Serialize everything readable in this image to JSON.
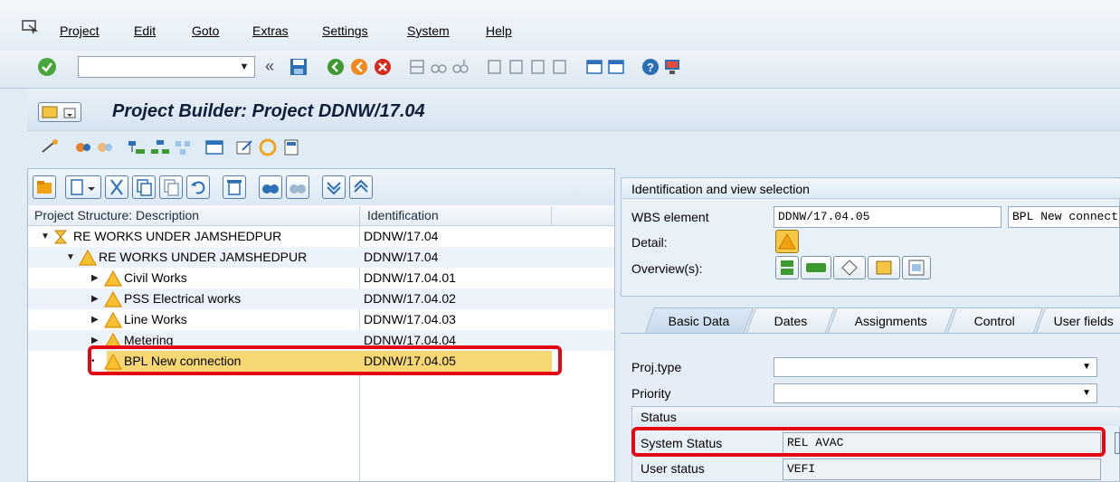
{
  "menu": {
    "items": [
      "Project",
      "Edit",
      "Goto",
      "Extras",
      "Settings",
      "System",
      "Help"
    ]
  },
  "toolbar": {
    "command_value": "",
    "icons": [
      "enter-icon",
      "back-icon",
      "save-icon",
      "back-green-icon",
      "exit-icon",
      "cancel-icon",
      "print-icon",
      "find-icon",
      "find-next-icon",
      "first-page-icon",
      "prev-page-icon",
      "next-page-icon",
      "last-page-icon",
      "new-session-icon",
      "shortcut-icon",
      "help-icon",
      "customize-icon"
    ]
  },
  "title": {
    "text": "Project Builder: Project DDNW/17.04"
  },
  "tree": {
    "col_description": "Project Structure: Description",
    "col_identification": "Identification",
    "rows": [
      {
        "description": "RE WORKS UNDER JAMSHEDPUR",
        "id": "DDNW/17.04",
        "level": 0,
        "icon": "project-icon",
        "expanded": true
      },
      {
        "description": "RE WORKS UNDER JAMSHEDPUR",
        "id": "DDNW/17.04",
        "level": 1,
        "icon": "warning-icon",
        "expanded": true
      },
      {
        "description": "Civil Works",
        "id": "DDNW/17.04.01",
        "level": 2,
        "icon": "warning-icon",
        "expanded": false
      },
      {
        "description": "PSS Electrical works",
        "id": "DDNW/17.04.02",
        "level": 2,
        "icon": "warning-icon",
        "expanded": false
      },
      {
        "description": "Line Works",
        "id": "DDNW/17.04.03",
        "level": 2,
        "icon": "warning-icon",
        "expanded": false
      },
      {
        "description": "Metering",
        "id": "DDNW/17.04.04",
        "level": 2,
        "icon": "warning-icon",
        "expanded": false
      },
      {
        "description": "BPL New connection",
        "id": "DDNW/17.04.05",
        "level": 2,
        "icon": "warning-icon",
        "expanded": false,
        "selected": true
      }
    ]
  },
  "ident": {
    "title": "Identification and view selection",
    "wbs_label": "WBS element",
    "wbs_value": "DDNW/17.04.05",
    "wbs_desc": "BPL New connection",
    "detail_label": "Detail:",
    "overview_label": "Overview(s):"
  },
  "tabs": [
    "Basic Data",
    "Dates",
    "Assignments",
    "Control",
    "User fields"
  ],
  "basic": {
    "proj_type_label": "Proj.type",
    "proj_type_value": "",
    "priority_label": "Priority",
    "priority_value": "",
    "status_title": "Status",
    "system_status_label": "System Status",
    "system_status_value": "REL  AVAC",
    "user_status_label": "User status",
    "user_status_value": "VEFI"
  },
  "colors": {
    "highlight": "#e30613",
    "selected_row": "#f7d774",
    "warning": "#f2a20f"
  }
}
